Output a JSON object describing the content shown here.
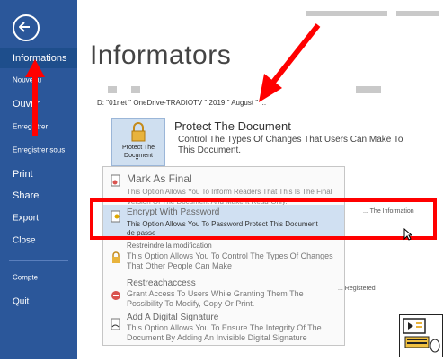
{
  "sidebar": {
    "items": [
      {
        "label": "Informations",
        "active": true
      },
      {
        "label": "Nouveau"
      },
      {
        "label": "Ouvrir"
      },
      {
        "label": "Enregistrer"
      },
      {
        "label": "Enregistrer sous"
      },
      {
        "label": "Print"
      },
      {
        "label": "Share"
      },
      {
        "label": "Export"
      },
      {
        "label": "Close"
      },
      {
        "label": "Compte"
      },
      {
        "label": "Quit"
      }
    ]
  },
  "main": {
    "title": "Informators",
    "path": "D: \"01net \" OneDrive-TRADIOTV \" 2019 \" August \" ..."
  },
  "protect": {
    "tile_label": "Protect The Document",
    "tile_caret": "▾",
    "title": "Protect The Document",
    "description": "Control The Types Of Changes That Users Can Make To This Document."
  },
  "dropdown": {
    "items": [
      {
        "title": "Mark As Final",
        "desc": "This Option Allows You To Inform Readers That This Is The Final Version Of The Document And Make It Read-Only."
      },
      {
        "title": "Encrypt With Password",
        "desc": "This Option Allows You To Password Protect This Document",
        "desc2": "de passe"
      },
      {
        "title": "Restreindre la modification",
        "desc": "This Option Allows You To Control The Types Of Changes That Other People Can Make"
      },
      {
        "title": "Restreachaccess",
        "desc": "Grant Access To Users While Granting Them The Possibility To Modify, Copy Or Print."
      },
      {
        "title": "Add A Digital Signature",
        "desc": "This Option Allows You To Ensure The Integrity Of The Document By Adding An Invisible Digital Signature"
      }
    ]
  },
  "right_notes": {
    "info": "... The Information",
    "registered": "... Registered"
  },
  "colors": {
    "sidebar": "#2b579a",
    "annotation_red": "#ff0000",
    "highlight": "#d0e0f2"
  }
}
